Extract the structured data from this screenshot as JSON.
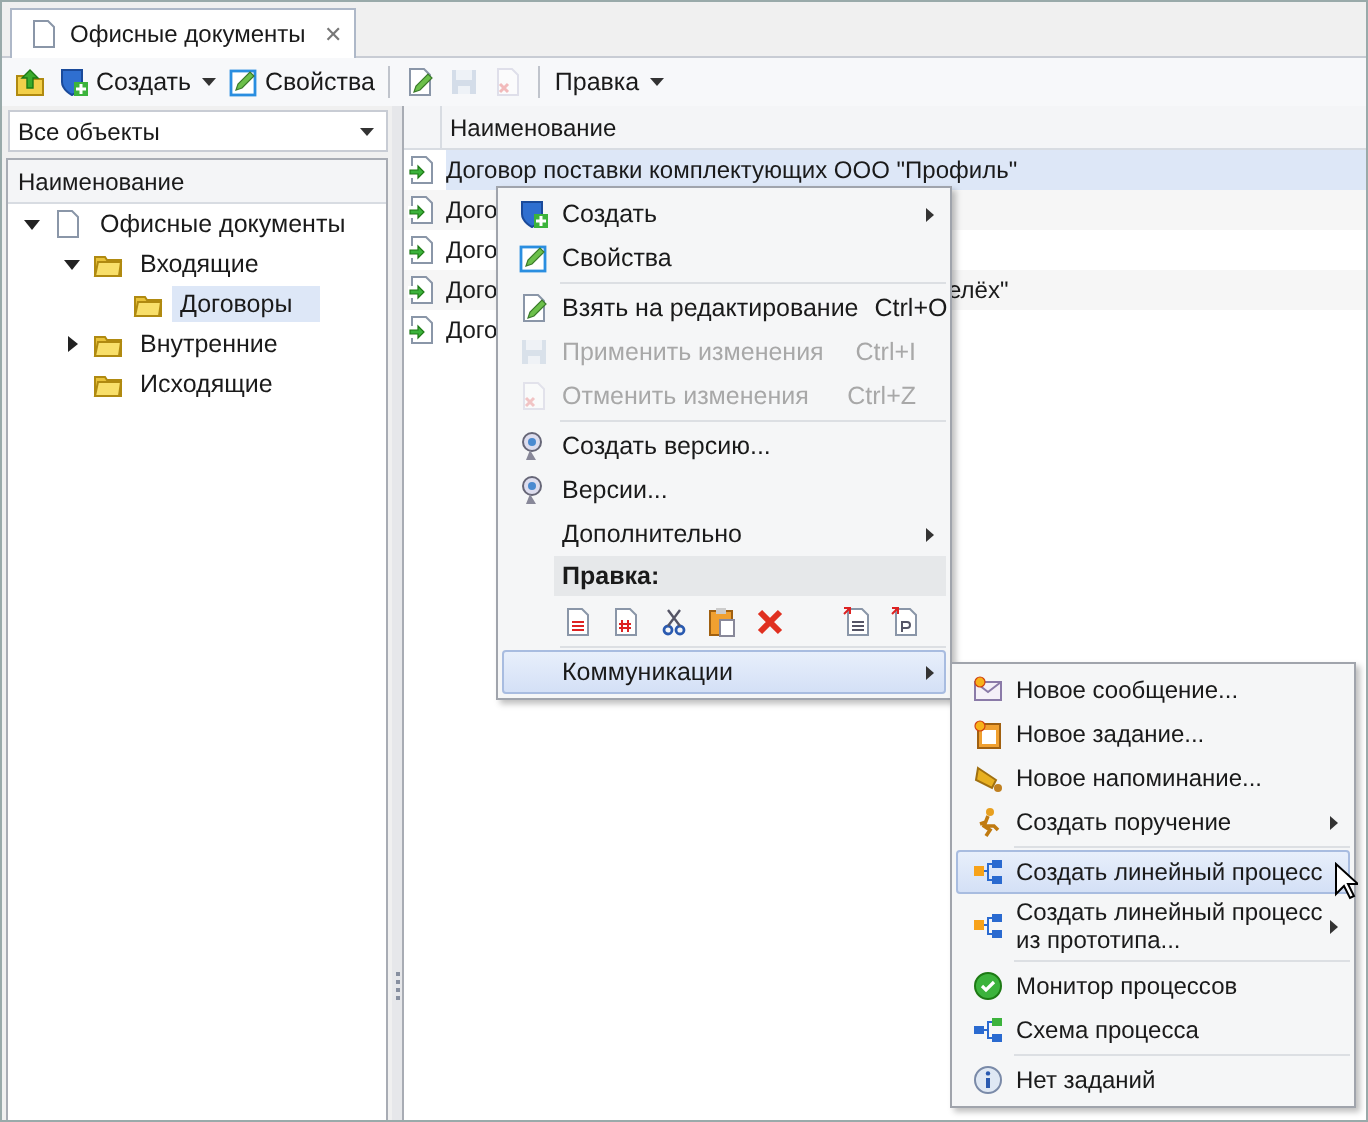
{
  "tabs": [
    {
      "label": "Офисные документы",
      "selected": true,
      "close": "✕"
    }
  ],
  "toolbar": [
    {
      "kind": "icon",
      "disabled": false
    },
    {
      "kind": "dropdown",
      "label": "Создать",
      "disabled": false
    },
    {
      "kind": "labeled",
      "label": "Свойства",
      "disabled": false
    },
    {
      "kind": "separator"
    },
    {
      "kind": "icon",
      "disabled": false
    },
    {
      "kind": "icon",
      "disabled": true
    },
    {
      "kind": "icon",
      "disabled": true
    },
    {
      "kind": "separator"
    },
    {
      "kind": "dropdown",
      "label": "Правка",
      "disabled": false
    }
  ],
  "filter": {
    "value": "Все объекты"
  },
  "tree": {
    "header": "Наименование",
    "items": [
      {
        "label": "Офисные документы",
        "kind": "root",
        "expanded": true,
        "selected": false,
        "children": [
          {
            "label": "Входящие",
            "kind": "folder",
            "expanded": true,
            "selected": false,
            "children": [
              {
                "label": "Договоры",
                "kind": "folder",
                "selected": true
              }
            ]
          },
          {
            "label": "Внутренние",
            "kind": "folder",
            "expanded": false,
            "selected": false
          },
          {
            "label": "Исходящие",
            "kind": "folder",
            "selected": false
          }
        ]
      }
    ]
  },
  "list": {
    "header": "Наименование",
    "rows": [
      {
        "text": "Договор поставки комплектующих ООО \"Профиль\"",
        "selected": true
      },
      {
        "text": "Дого",
        "selected": false
      },
      {
        "text": "Дого",
        "selected": false
      },
      {
        "text": "Дого",
        "tail": "елёх\"",
        "selected": false
      },
      {
        "text": "Дого",
        "selected": false
      }
    ]
  },
  "context_menu": [
    {
      "kind": "item",
      "label": "Создать",
      "submenu": true,
      "disabled": false,
      "selected": false
    },
    {
      "kind": "item",
      "label": "Свойства",
      "disabled": false,
      "selected": false
    },
    {
      "kind": "separator"
    },
    {
      "kind": "item",
      "label": "Взять на редактирование",
      "shortcut": "Ctrl+O",
      "disabled": false,
      "selected": false
    },
    {
      "kind": "item",
      "label": "Применить изменения",
      "shortcut": "Ctrl+I",
      "disabled": true,
      "selected": false
    },
    {
      "kind": "item",
      "label": "Отменить изменения",
      "shortcut": "Ctrl+Z",
      "disabled": true,
      "selected": false
    },
    {
      "kind": "separator"
    },
    {
      "kind": "item",
      "label": "Создать версию...",
      "disabled": false,
      "selected": false
    },
    {
      "kind": "item",
      "label": "Версии...",
      "disabled": false,
      "selected": false
    },
    {
      "kind": "item",
      "label": "Дополнительно",
      "submenu": true,
      "disabled": false,
      "selected": false
    },
    {
      "kind": "group",
      "label": "Правка:"
    },
    {
      "kind": "separator"
    },
    {
      "kind": "item",
      "label": "Коммуникации",
      "submenu": true,
      "disabled": false,
      "selected": true
    }
  ],
  "submenu": [
    {
      "kind": "item",
      "label": "Новое сообщение...",
      "selected": false
    },
    {
      "kind": "item",
      "label": "Новое задание...",
      "selected": false
    },
    {
      "kind": "item",
      "label": "Новое напоминание...",
      "selected": false
    },
    {
      "kind": "item",
      "label": "Создать поручение",
      "submenu": true,
      "selected": false
    },
    {
      "kind": "separator"
    },
    {
      "kind": "item",
      "label": "Создать линейный процесс",
      "selected": true
    },
    {
      "kind": "item",
      "label": "Создать линейный процесс",
      "label2": "из прототипа...",
      "submenu": true,
      "selected": false
    },
    {
      "kind": "separator"
    },
    {
      "kind": "item",
      "label": "Монитор процессов",
      "selected": false
    },
    {
      "kind": "item",
      "label": "Схема процесса",
      "selected": false
    },
    {
      "kind": "separator"
    },
    {
      "kind": "item",
      "label": "Нет заданий",
      "selected": false
    }
  ]
}
